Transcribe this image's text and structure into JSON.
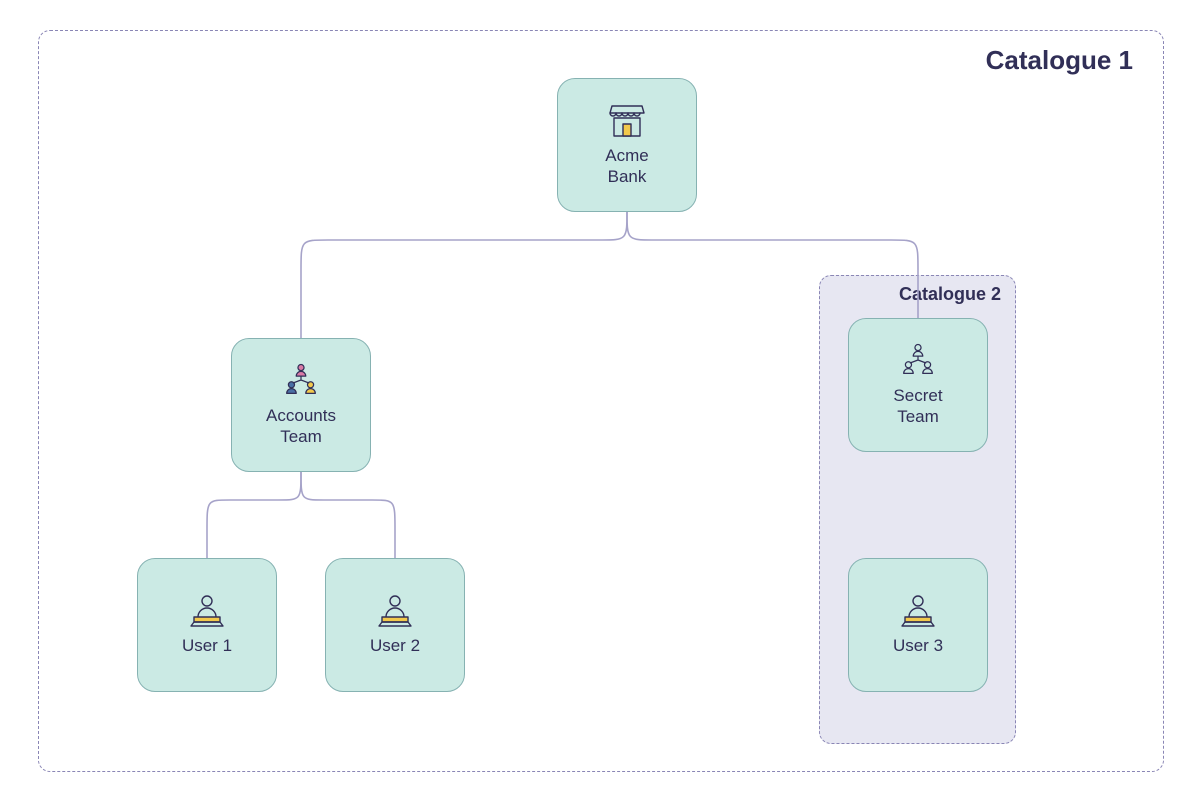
{
  "catalogue1": {
    "title": "Catalogue 1"
  },
  "catalogue2": {
    "title": "Catalogue 2"
  },
  "nodes": {
    "root": {
      "label": "Acme\nBank"
    },
    "team1": {
      "label": "Accounts\nTeam"
    },
    "team2": {
      "label": "Secret\nTeam"
    },
    "user1": {
      "label": "User 1"
    },
    "user2": {
      "label": "User 2"
    },
    "user3": {
      "label": "User 3"
    }
  },
  "colors": {
    "nodeFill": "#cbeae4",
    "nodeBorder": "#86b2b2",
    "dash": "#8a86b5",
    "text": "#312f57",
    "cat2Fill": "#e7e7f2",
    "connector": "#a6a3c9",
    "accentYellow": "#f2c94c",
    "accentBlue": "#4a6fa5",
    "accentPink": "#d97aa6",
    "accentGreen": "#6fbf9e"
  }
}
